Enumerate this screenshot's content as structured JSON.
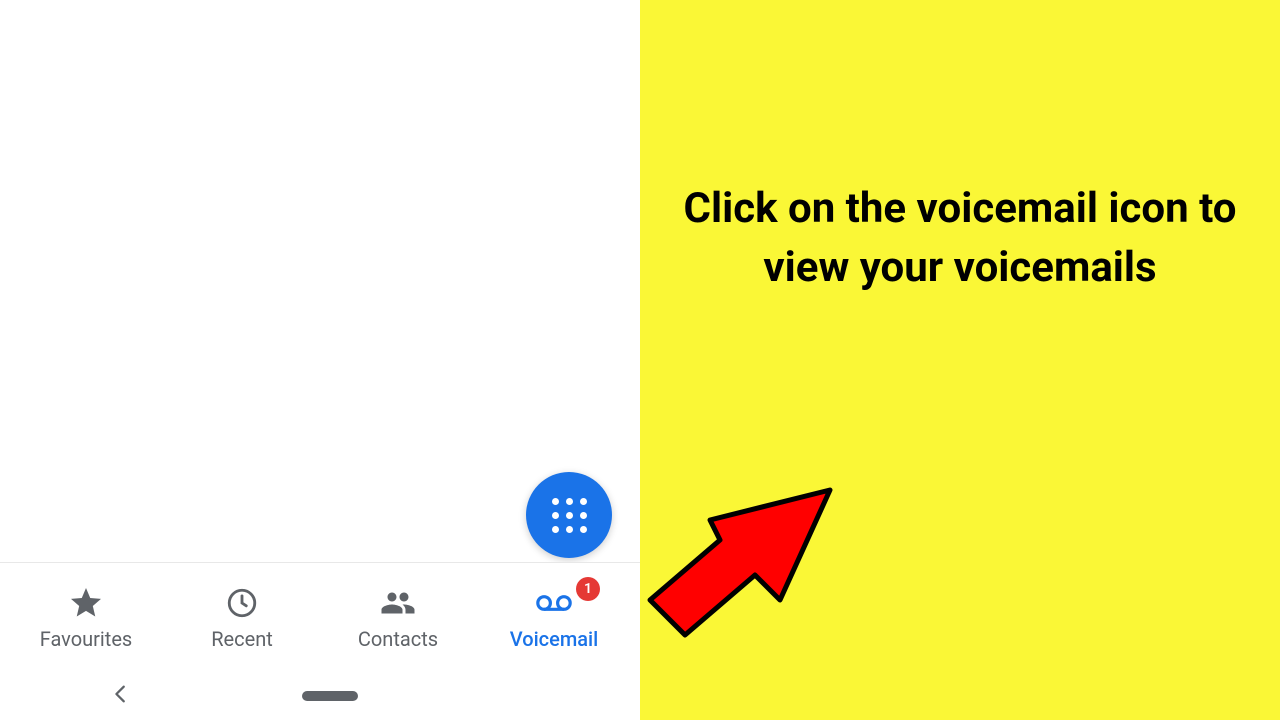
{
  "instruction": "Click on the voicemail icon to view your voicemails",
  "nav": {
    "favourites": "Favourites",
    "recent": "Recent",
    "contacts": "Contacts",
    "voicemail": "Voicemail"
  },
  "badge_count": "1",
  "colors": {
    "accent": "#1a73e8",
    "badge": "#e53935",
    "highlight": "#faf736",
    "text_inactive": "#5f6368"
  }
}
